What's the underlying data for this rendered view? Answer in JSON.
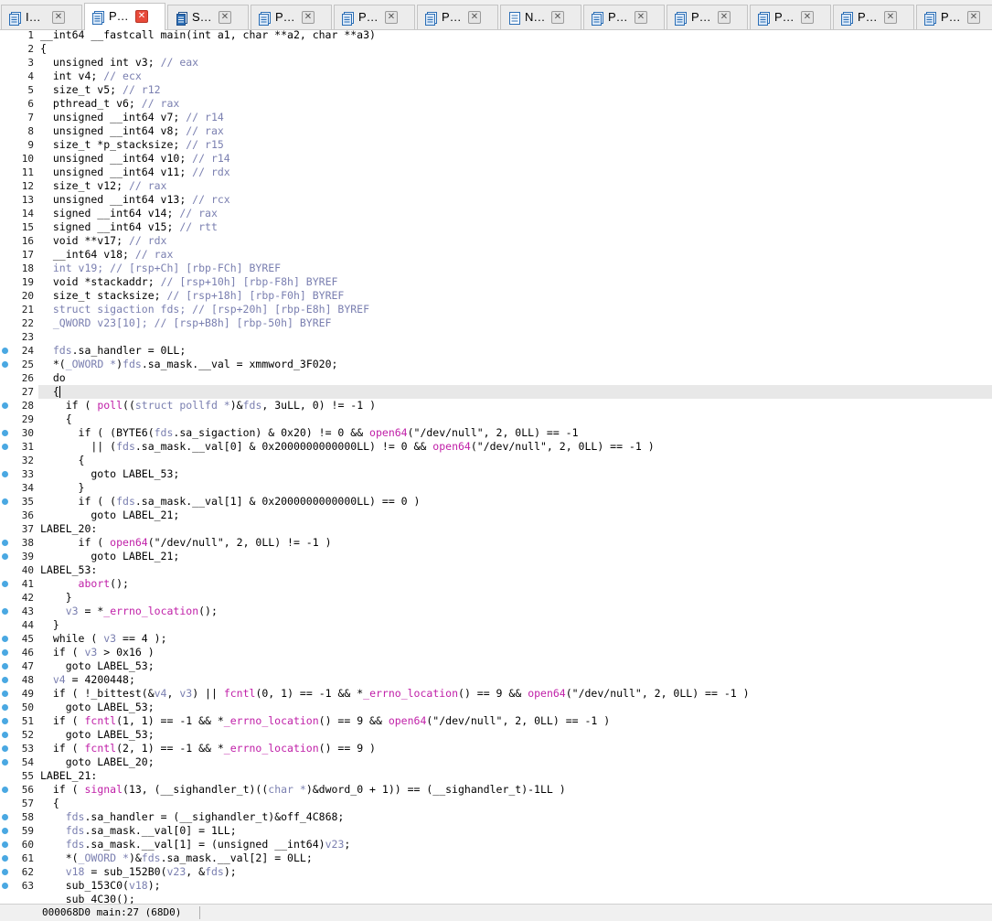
{
  "tabs": [
    {
      "label": "I…",
      "icon": "pseudocode-icon",
      "active": false
    },
    {
      "label": "P…",
      "icon": "pseudocode-icon",
      "active": true
    },
    {
      "label": "S…",
      "icon": "strings-icon",
      "active": false
    },
    {
      "label": "P…",
      "icon": "pseudocode-icon",
      "active": false
    },
    {
      "label": "P…",
      "icon": "pseudocode-icon",
      "active": false
    },
    {
      "label": "P…",
      "icon": "pseudocode-icon",
      "active": false
    },
    {
      "label": "N…",
      "icon": "names-icon",
      "active": false
    },
    {
      "label": "P…",
      "icon": "pseudocode-icon",
      "active": false
    },
    {
      "label": "P…",
      "icon": "pseudocode-icon",
      "active": false
    },
    {
      "label": "P…",
      "icon": "pseudocode-icon",
      "active": false
    },
    {
      "label": "P…",
      "icon": "pseudocode-icon",
      "active": false
    },
    {
      "label": "P…",
      "icon": "pseudocode-icon",
      "active": false
    }
  ],
  "tab_close_glyph": "✕",
  "colors": {
    "comment": "#7a7fb0",
    "function": "#c020a8",
    "breakpoint_dot": "#4aa8e2",
    "current_line": "#e8e8e8",
    "active_tab_close": "#e84a3a"
  },
  "current_line_number": 27,
  "code_lines": [
    {
      "n": "1",
      "bp": false,
      "tokens": [
        [
          "k",
          "__int64 __fastcall main(int a1, char **a2, char **a3)"
        ]
      ]
    },
    {
      "n": "2",
      "bp": false,
      "tokens": [
        [
          "k",
          "{"
        ]
      ]
    },
    {
      "n": "3",
      "bp": false,
      "tokens": [
        [
          "k",
          "  unsigned int v3; "
        ],
        [
          "c",
          "// eax"
        ]
      ]
    },
    {
      "n": "4",
      "bp": false,
      "tokens": [
        [
          "k",
          "  int v4; "
        ],
        [
          "c",
          "// ecx"
        ]
      ]
    },
    {
      "n": "5",
      "bp": false,
      "tokens": [
        [
          "k",
          "  size_t v5; "
        ],
        [
          "c",
          "// r12"
        ]
      ]
    },
    {
      "n": "6",
      "bp": false,
      "tokens": [
        [
          "k",
          "  pthread_t v6; "
        ],
        [
          "c",
          "// rax"
        ]
      ]
    },
    {
      "n": "7",
      "bp": false,
      "tokens": [
        [
          "k",
          "  unsigned __int64 v7; "
        ],
        [
          "c",
          "// r14"
        ]
      ]
    },
    {
      "n": "8",
      "bp": false,
      "tokens": [
        [
          "k",
          "  unsigned __int64 v8; "
        ],
        [
          "c",
          "// rax"
        ]
      ]
    },
    {
      "n": "9",
      "bp": false,
      "tokens": [
        [
          "k",
          "  size_t *p_stacksize; "
        ],
        [
          "c",
          "// r15"
        ]
      ]
    },
    {
      "n": "10",
      "bp": false,
      "tokens": [
        [
          "k",
          "  unsigned __int64 v10; "
        ],
        [
          "c",
          "// r14"
        ]
      ]
    },
    {
      "n": "11",
      "bp": false,
      "tokens": [
        [
          "k",
          "  unsigned __int64 v11; "
        ],
        [
          "c",
          "// rdx"
        ]
      ]
    },
    {
      "n": "12",
      "bp": false,
      "tokens": [
        [
          "k",
          "  size_t v12; "
        ],
        [
          "c",
          "// rax"
        ]
      ]
    },
    {
      "n": "13",
      "bp": false,
      "tokens": [
        [
          "k",
          "  unsigned __int64 v13; "
        ],
        [
          "c",
          "// rcx"
        ]
      ]
    },
    {
      "n": "14",
      "bp": false,
      "tokens": [
        [
          "k",
          "  signed __int64 v14; "
        ],
        [
          "c",
          "// rax"
        ]
      ]
    },
    {
      "n": "15",
      "bp": false,
      "tokens": [
        [
          "k",
          "  signed __int64 v15; "
        ],
        [
          "c",
          "// rtt"
        ]
      ]
    },
    {
      "n": "16",
      "bp": false,
      "tokens": [
        [
          "k",
          "  void **v17; "
        ],
        [
          "c",
          "// rdx"
        ]
      ]
    },
    {
      "n": "17",
      "bp": false,
      "tokens": [
        [
          "k",
          "  __int64 v18; "
        ],
        [
          "c",
          "// rax"
        ]
      ]
    },
    {
      "n": "18",
      "bp": false,
      "tokens": [
        [
          "g",
          "  int v19; "
        ],
        [
          "c",
          "// [rsp+Ch] [rbp-FCh] BYREF"
        ]
      ]
    },
    {
      "n": "19",
      "bp": false,
      "tokens": [
        [
          "k",
          "  void *stackaddr; "
        ],
        [
          "c",
          "// [rsp+10h] [rbp-F8h] BYREF"
        ]
      ]
    },
    {
      "n": "20",
      "bp": false,
      "tokens": [
        [
          "k",
          "  size_t stacksize; "
        ],
        [
          "c",
          "// [rsp+18h] [rbp-F0h] BYREF"
        ]
      ]
    },
    {
      "n": "21",
      "bp": false,
      "tokens": [
        [
          "g",
          "  struct sigaction fds; "
        ],
        [
          "c",
          "// [rsp+20h] [rbp-E8h] BYREF"
        ]
      ]
    },
    {
      "n": "22",
      "bp": false,
      "tokens": [
        [
          "g",
          "  _QWORD v23[10]; "
        ],
        [
          "c",
          "// [rsp+B8h] [rbp-50h] BYREF"
        ]
      ]
    },
    {
      "n": "23",
      "bp": false,
      "tokens": [
        [
          "k",
          ""
        ]
      ]
    },
    {
      "n": "24",
      "bp": true,
      "tokens": [
        [
          "v",
          "  fds"
        ],
        [
          "k",
          ".sa_handler = 0LL;"
        ]
      ]
    },
    {
      "n": "25",
      "bp": true,
      "tokens": [
        [
          "k",
          "  *("
        ],
        [
          "v",
          "_OWORD *"
        ],
        [
          "k",
          ")"
        ],
        [
          "v",
          "fds"
        ],
        [
          "k",
          ".sa_mask.__val = xmmword_3F020;"
        ]
      ]
    },
    {
      "n": "26",
      "bp": false,
      "tokens": [
        [
          "k",
          "  do"
        ]
      ]
    },
    {
      "n": "27",
      "bp": false,
      "tokens": [
        [
          "k",
          "  {"
        ]
      ]
    },
    {
      "n": "28",
      "bp": true,
      "tokens": [
        [
          "k",
          "    if ( "
        ],
        [
          "f",
          "poll"
        ],
        [
          "k",
          "(("
        ],
        [
          "v",
          "struct pollfd *"
        ],
        [
          "k",
          ")&"
        ],
        [
          "v",
          "fds"
        ],
        [
          "k",
          ", 3uLL, 0) != -1 )"
        ]
      ]
    },
    {
      "n": "29",
      "bp": false,
      "tokens": [
        [
          "k",
          "    {"
        ]
      ]
    },
    {
      "n": "30",
      "bp": true,
      "tokens": [
        [
          "k",
          "      if ( (BYTE6("
        ],
        [
          "v",
          "fds"
        ],
        [
          "k",
          ".sa_sigaction) & 0x20) != 0 && "
        ],
        [
          "f",
          "open64"
        ],
        [
          "k",
          "(\"/dev/null\", 2, 0LL) == -1"
        ]
      ]
    },
    {
      "n": "31",
      "bp": true,
      "tokens": [
        [
          "k",
          "        || ("
        ],
        [
          "v",
          "fds"
        ],
        [
          "k",
          ".sa_mask.__val[0] & 0x2000000000000LL) != 0 && "
        ],
        [
          "f",
          "open64"
        ],
        [
          "k",
          "(\"/dev/null\", 2, 0LL) == -1 )"
        ]
      ]
    },
    {
      "n": "32",
      "bp": false,
      "tokens": [
        [
          "k",
          "      {"
        ]
      ]
    },
    {
      "n": "33",
      "bp": true,
      "tokens": [
        [
          "k",
          "        goto LABEL_53;"
        ]
      ]
    },
    {
      "n": "34",
      "bp": false,
      "tokens": [
        [
          "k",
          "      }"
        ]
      ]
    },
    {
      "n": "35",
      "bp": true,
      "tokens": [
        [
          "k",
          "      if ( ("
        ],
        [
          "v",
          "fds"
        ],
        [
          "k",
          ".sa_mask.__val[1] & 0x2000000000000LL) == 0 )"
        ]
      ]
    },
    {
      "n": "36",
      "bp": false,
      "tokens": [
        [
          "k",
          "        goto LABEL_21;"
        ]
      ]
    },
    {
      "n": "37",
      "bp": false,
      "tokens": [
        [
          "k",
          "LABEL_20:"
        ]
      ]
    },
    {
      "n": "38",
      "bp": true,
      "tokens": [
        [
          "k",
          "      if ( "
        ],
        [
          "f",
          "open64"
        ],
        [
          "k",
          "(\"/dev/null\", 2, 0LL) != -1 )"
        ]
      ]
    },
    {
      "n": "39",
      "bp": true,
      "tokens": [
        [
          "k",
          "        goto LABEL_21;"
        ]
      ]
    },
    {
      "n": "40",
      "bp": false,
      "tokens": [
        [
          "k",
          "LABEL_53:"
        ]
      ]
    },
    {
      "n": "41",
      "bp": true,
      "tokens": [
        [
          "k",
          "      "
        ],
        [
          "f",
          "abort"
        ],
        [
          "k",
          "();"
        ]
      ]
    },
    {
      "n": "42",
      "bp": false,
      "tokens": [
        [
          "k",
          "    }"
        ]
      ]
    },
    {
      "n": "43",
      "bp": true,
      "tokens": [
        [
          "k",
          "    "
        ],
        [
          "v",
          "v3"
        ],
        [
          "k",
          " = *"
        ],
        [
          "f",
          "_errno_location"
        ],
        [
          "k",
          "();"
        ]
      ]
    },
    {
      "n": "44",
      "bp": false,
      "tokens": [
        [
          "k",
          "  }"
        ]
      ]
    },
    {
      "n": "45",
      "bp": true,
      "tokens": [
        [
          "k",
          "  while ( "
        ],
        [
          "v",
          "v3"
        ],
        [
          "k",
          " == 4 );"
        ]
      ]
    },
    {
      "n": "46",
      "bp": true,
      "tokens": [
        [
          "k",
          "  if ( "
        ],
        [
          "v",
          "v3"
        ],
        [
          "k",
          " > 0x16 )"
        ]
      ]
    },
    {
      "n": "47",
      "bp": true,
      "tokens": [
        [
          "k",
          "    goto LABEL_53;"
        ]
      ]
    },
    {
      "n": "48",
      "bp": true,
      "tokens": [
        [
          "k",
          "  "
        ],
        [
          "v",
          "v4"
        ],
        [
          "k",
          " = 4200448;"
        ]
      ]
    },
    {
      "n": "49",
      "bp": true,
      "tokens": [
        [
          "k",
          "  if ( !_bittest(&"
        ],
        [
          "v",
          "v4"
        ],
        [
          "k",
          ", "
        ],
        [
          "v",
          "v3"
        ],
        [
          "k",
          ") || "
        ],
        [
          "f",
          "fcntl"
        ],
        [
          "k",
          "(0, 1) == -1 && *"
        ],
        [
          "f",
          "_errno_location"
        ],
        [
          "k",
          "() == 9 && "
        ],
        [
          "f",
          "open64"
        ],
        [
          "k",
          "(\"/dev/null\", 2, 0LL) == -1 )"
        ]
      ]
    },
    {
      "n": "50",
      "bp": true,
      "tokens": [
        [
          "k",
          "    goto LABEL_53;"
        ]
      ]
    },
    {
      "n": "51",
      "bp": true,
      "tokens": [
        [
          "k",
          "  if ( "
        ],
        [
          "f",
          "fcntl"
        ],
        [
          "k",
          "(1, 1) == -1 && *"
        ],
        [
          "f",
          "_errno_location"
        ],
        [
          "k",
          "() == 9 && "
        ],
        [
          "f",
          "open64"
        ],
        [
          "k",
          "(\"/dev/null\", 2, 0LL) == -1 )"
        ]
      ]
    },
    {
      "n": "52",
      "bp": true,
      "tokens": [
        [
          "k",
          "    goto LABEL_53;"
        ]
      ]
    },
    {
      "n": "53",
      "bp": true,
      "tokens": [
        [
          "k",
          "  if ( "
        ],
        [
          "f",
          "fcntl"
        ],
        [
          "k",
          "(2, 1) == -1 && *"
        ],
        [
          "f",
          "_errno_location"
        ],
        [
          "k",
          "() == 9 )"
        ]
      ]
    },
    {
      "n": "54",
      "bp": true,
      "tokens": [
        [
          "k",
          "    goto LABEL_20;"
        ]
      ]
    },
    {
      "n": "55",
      "bp": false,
      "tokens": [
        [
          "k",
          "LABEL_21:"
        ]
      ]
    },
    {
      "n": "56",
      "bp": true,
      "tokens": [
        [
          "k",
          "  if ( "
        ],
        [
          "f",
          "signal"
        ],
        [
          "k",
          "(13, (__sighandler_t)(("
        ],
        [
          "v",
          "char *"
        ],
        [
          "k",
          ")&dword_0 + 1)) == (__sighandler_t)-1LL )"
        ]
      ]
    },
    {
      "n": "57",
      "bp": false,
      "tokens": [
        [
          "k",
          "  {"
        ]
      ]
    },
    {
      "n": "58",
      "bp": true,
      "tokens": [
        [
          "k",
          "    "
        ],
        [
          "v",
          "fds"
        ],
        [
          "k",
          ".sa_handler = (__sighandler_t)&off_4C868;"
        ]
      ]
    },
    {
      "n": "59",
      "bp": true,
      "tokens": [
        [
          "k",
          "    "
        ],
        [
          "v",
          "fds"
        ],
        [
          "k",
          ".sa_mask.__val[0] = 1LL;"
        ]
      ]
    },
    {
      "n": "60",
      "bp": true,
      "tokens": [
        [
          "k",
          "    "
        ],
        [
          "v",
          "fds"
        ],
        [
          "k",
          ".sa_mask.__val[1] = (unsigned __int64)"
        ],
        [
          "v",
          "v23"
        ],
        [
          "k",
          ";"
        ]
      ]
    },
    {
      "n": "61",
      "bp": true,
      "tokens": [
        [
          "k",
          "    *("
        ],
        [
          "v",
          "_OWORD *"
        ],
        [
          "k",
          ")&"
        ],
        [
          "v",
          "fds"
        ],
        [
          "k",
          ".sa_mask.__val[2] = 0LL;"
        ]
      ]
    },
    {
      "n": "62",
      "bp": true,
      "tokens": [
        [
          "k",
          "    "
        ],
        [
          "v",
          "v18"
        ],
        [
          "k",
          " = sub_152B0("
        ],
        [
          "v",
          "v23"
        ],
        [
          "k",
          ", &"
        ],
        [
          "v",
          "fds"
        ],
        [
          "k",
          ");"
        ]
      ]
    },
    {
      "n": "63",
      "bp": true,
      "tokens": [
        [
          "k",
          "    sub_153C0("
        ],
        [
          "v",
          "v18"
        ],
        [
          "k",
          ");"
        ]
      ]
    },
    {
      "n": "",
      "bp": false,
      "tokens": [
        [
          "k",
          "    sub_4C30();"
        ]
      ]
    }
  ],
  "statusbar": {
    "position": "000068D0 main:27 (68D0)"
  }
}
